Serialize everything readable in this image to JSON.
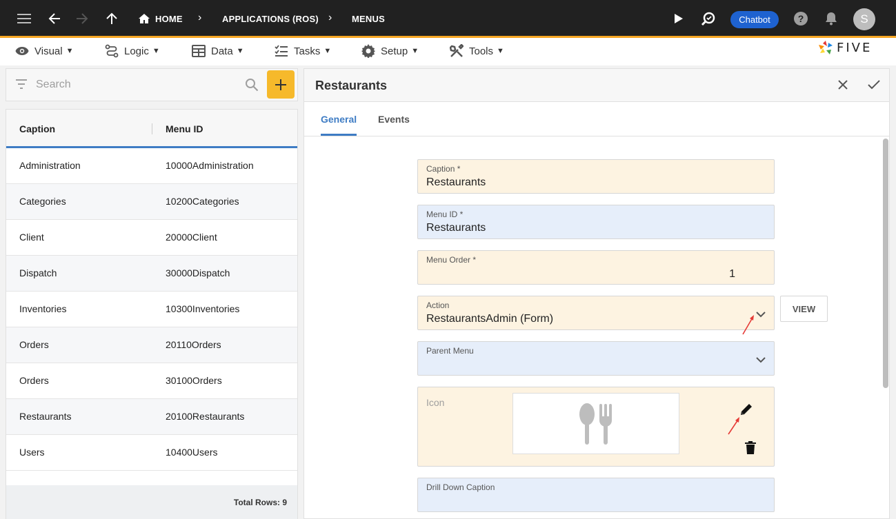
{
  "topbar": {
    "breadcrumbs": [
      "HOME",
      "APPLICATIONS (ROS)",
      "MENUS"
    ],
    "chatbot_label": "Chatbot",
    "avatar_initial": "S"
  },
  "menubar": {
    "items": [
      {
        "label": "Visual",
        "icon": "eye-icon"
      },
      {
        "label": "Logic",
        "icon": "logic-icon"
      },
      {
        "label": "Data",
        "icon": "table-icon"
      },
      {
        "label": "Tasks",
        "icon": "tasks-icon"
      },
      {
        "label": "Setup",
        "icon": "gear-icon"
      },
      {
        "label": "Tools",
        "icon": "tools-icon"
      }
    ],
    "logo_text": "FIVE"
  },
  "list": {
    "search_placeholder": "Search",
    "columns": [
      "Caption",
      "Menu ID"
    ],
    "rows": [
      {
        "caption": "Administration",
        "menu_id": "10000Administration"
      },
      {
        "caption": "Categories",
        "menu_id": "10200Categories"
      },
      {
        "caption": "Client",
        "menu_id": "20000Client"
      },
      {
        "caption": "Dispatch",
        "menu_id": "30000Dispatch"
      },
      {
        "caption": "Inventories",
        "menu_id": "10300Inventories"
      },
      {
        "caption": "Orders",
        "menu_id": "20110Orders"
      },
      {
        "caption": "Orders",
        "menu_id": "30100Orders"
      },
      {
        "caption": "Restaurants",
        "menu_id": "20100Restaurants"
      },
      {
        "caption": "Users",
        "menu_id": "10400Users"
      }
    ],
    "total_rows": "Total Rows: 9"
  },
  "form": {
    "title": "Restaurants",
    "tabs": [
      "General",
      "Events"
    ],
    "fields": {
      "caption": {
        "label": "Caption *",
        "value": "Restaurants"
      },
      "menu_id": {
        "label": "Menu ID *",
        "value": "Restaurants"
      },
      "menu_order": {
        "label": "Menu Order *",
        "value": "1"
      },
      "action": {
        "label": "Action",
        "value": "RestaurantsAdmin (Form)"
      },
      "parent_menu": {
        "label": "Parent Menu",
        "value": ""
      },
      "icon": {
        "label": "Icon"
      },
      "drill_down_caption": {
        "label": "Drill Down Caption",
        "value": ""
      }
    },
    "view_label": "VIEW"
  },
  "colors": {
    "topbar": "#212121",
    "accent_orange": "#f6a623",
    "add_button": "#f6b92b",
    "primary_blue": "#3e7cc4",
    "chatbot": "#1e62d0",
    "field_yellow": "#fdf3e1",
    "field_blue": "#e6eefa"
  }
}
